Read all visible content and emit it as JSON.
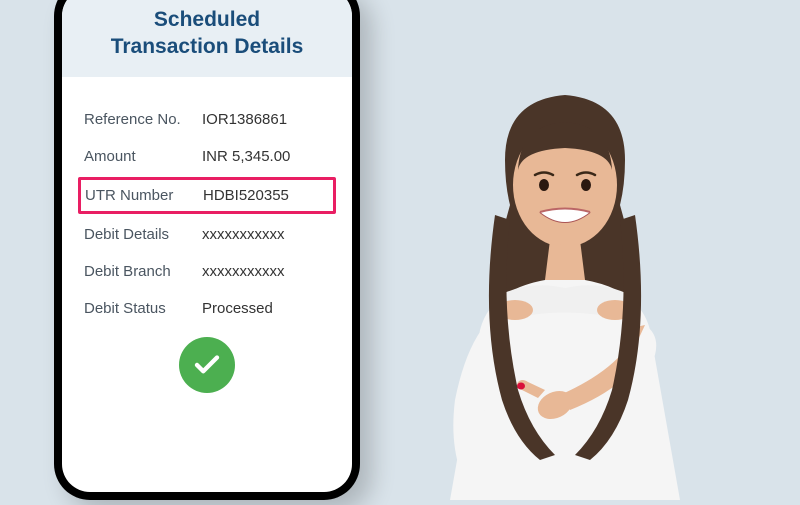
{
  "screen": {
    "title_line1": "Scheduled",
    "title_line2": "Transaction Details"
  },
  "details": {
    "reference_label": "Reference No.",
    "reference_value": "IOR1386861",
    "amount_label": "Amount",
    "amount_value": "INR 5,345.00",
    "utr_label": "UTR Number",
    "utr_value": "HDBI520355",
    "debit_details_label": "Debit Details",
    "debit_details_value": "xxxxxxxxxxx",
    "debit_branch_label": "Debit Branch",
    "debit_branch_value": "xxxxxxxxxxx",
    "debit_status_label": "Debit Status",
    "debit_status_value": "Processed"
  },
  "icons": {
    "success": "checkmark-icon"
  }
}
